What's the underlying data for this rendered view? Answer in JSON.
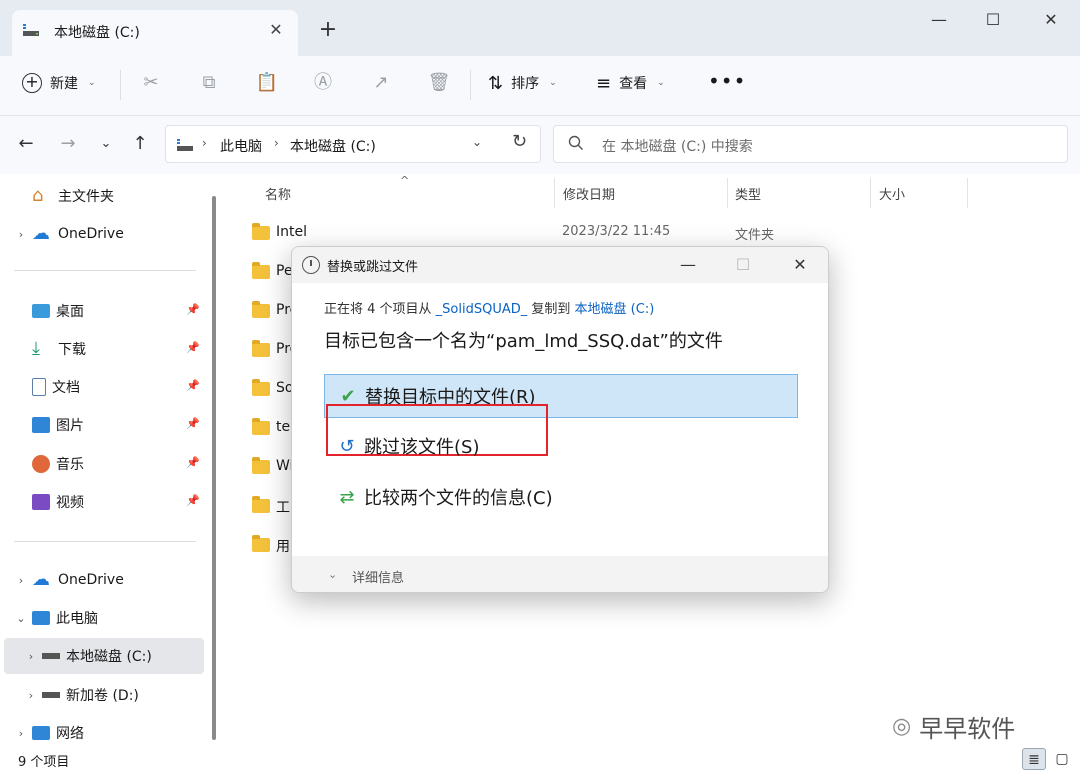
{
  "window": {
    "tab_title": "本地磁盘 (C:)",
    "new_tab": "+",
    "controls": {
      "minimize": "—",
      "maximize": "☐",
      "close": "✕"
    }
  },
  "toolbar": {
    "new_label": "新建",
    "sort_label": "排序",
    "view_label": "查看",
    "more_label": "•••"
  },
  "address": {
    "crumbs": [
      "此电脑",
      "本地磁盘 (C:)"
    ],
    "search_placeholder": "在 本地磁盘 (C:) 中搜索"
  },
  "sidebar": {
    "items": [
      {
        "label": "主文件夹",
        "icon": "home-icon"
      },
      {
        "label": "OneDrive",
        "icon": "cloud-icon"
      },
      {
        "label": "桌面",
        "icon": "desktop-icon"
      },
      {
        "label": "下载",
        "icon": "download-icon"
      },
      {
        "label": "文档",
        "icon": "document-icon"
      },
      {
        "label": "图片",
        "icon": "picture-icon"
      },
      {
        "label": "音乐",
        "icon": "music-icon"
      },
      {
        "label": "视频",
        "icon": "video-icon"
      },
      {
        "label": "OneDrive",
        "icon": "cloud-icon"
      },
      {
        "label": "此电脑",
        "icon": "computer-icon"
      },
      {
        "label": "本地磁盘 (C:)",
        "icon": "drive-icon"
      },
      {
        "label": "新加卷 (D:)",
        "icon": "drive-icon"
      },
      {
        "label": "网络",
        "icon": "network-icon"
      }
    ]
  },
  "filelist": {
    "headers": {
      "name": "名称",
      "modified": "修改日期",
      "type": "类型",
      "size": "大小"
    },
    "rows": [
      {
        "name": "Intel",
        "date": "2023/3/22 11:45",
        "type": "文件夹"
      },
      {
        "name": "Pe",
        "date": "",
        "type": ""
      },
      {
        "name": "Pro",
        "date": "",
        "type": ""
      },
      {
        "name": "Pro",
        "date": "",
        "type": ""
      },
      {
        "name": "So",
        "date": "",
        "type": ""
      },
      {
        "name": "ter",
        "date": "",
        "type": ""
      },
      {
        "name": "Wi",
        "date": "",
        "type": ""
      },
      {
        "name": "工",
        "date": "",
        "type": ""
      },
      {
        "name": "用",
        "date": "",
        "type": ""
      }
    ]
  },
  "status": {
    "count": "9 个项目",
    "watermark": "早早软件"
  },
  "dialog": {
    "title": "替换或跳过文件",
    "line1_prefix": "正在将 4 个项目从 ",
    "source": "_SolidSQUAD_",
    "line1_mid": " 复制到 ",
    "dest": "本地磁盘 (C:)",
    "line2": "目标已包含一个名为“pam_lmd_SSQ.dat”的文件",
    "options": [
      {
        "label": "替换目标中的文件(R)",
        "icon": "check-icon"
      },
      {
        "label": "跳过该文件(S)",
        "icon": "skip-icon"
      },
      {
        "label": "比较两个文件的信息(C)",
        "icon": "compare-icon"
      }
    ],
    "details": "详细信息"
  },
  "colors": {
    "accent": "#0a62c2",
    "highlight": "#cfe6f8",
    "annotation": "#e3242b",
    "check": "#3aa34b"
  }
}
